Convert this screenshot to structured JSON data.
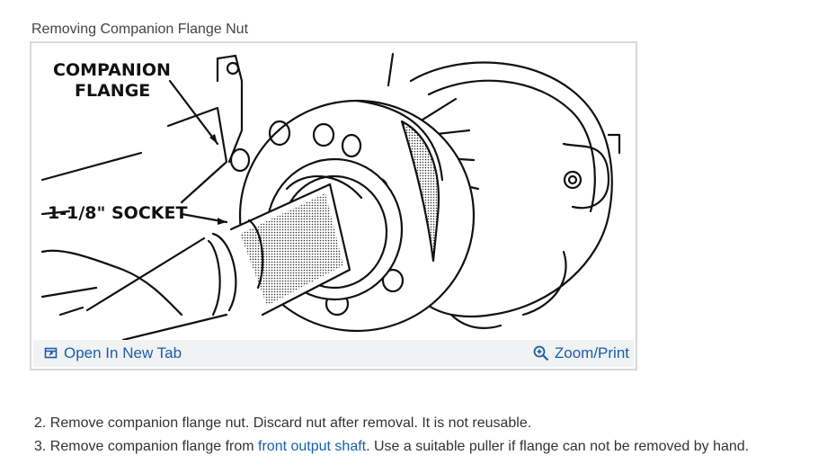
{
  "figure": {
    "caption": "Removing Companion Flange Nut",
    "callouts": {
      "flange_line1": "COMPANION",
      "flange_line2": "FLANGE",
      "socket": "1-1/8\" SOCKET"
    },
    "toolbar": {
      "open_in_new_tab": "Open In New Tab",
      "zoom_print": "Zoom/Print",
      "open_icon": "open-in-new-tab-icon",
      "zoom_icon": "magnifier-plus-icon"
    }
  },
  "steps": [
    {
      "number": "2.",
      "text": "Remove companion flange nut. Discard nut after removal. It is not reusable."
    },
    {
      "number": "3.",
      "text_before": "Remove companion flange from ",
      "link": "front output shaft",
      "text_after": ". Use a suitable puller if flange can not be removed by hand."
    }
  ],
  "colors": {
    "link": "#1a5ea8",
    "toolbar_bg": "#f0f2f4",
    "frame_border": "#d8d8d8"
  }
}
